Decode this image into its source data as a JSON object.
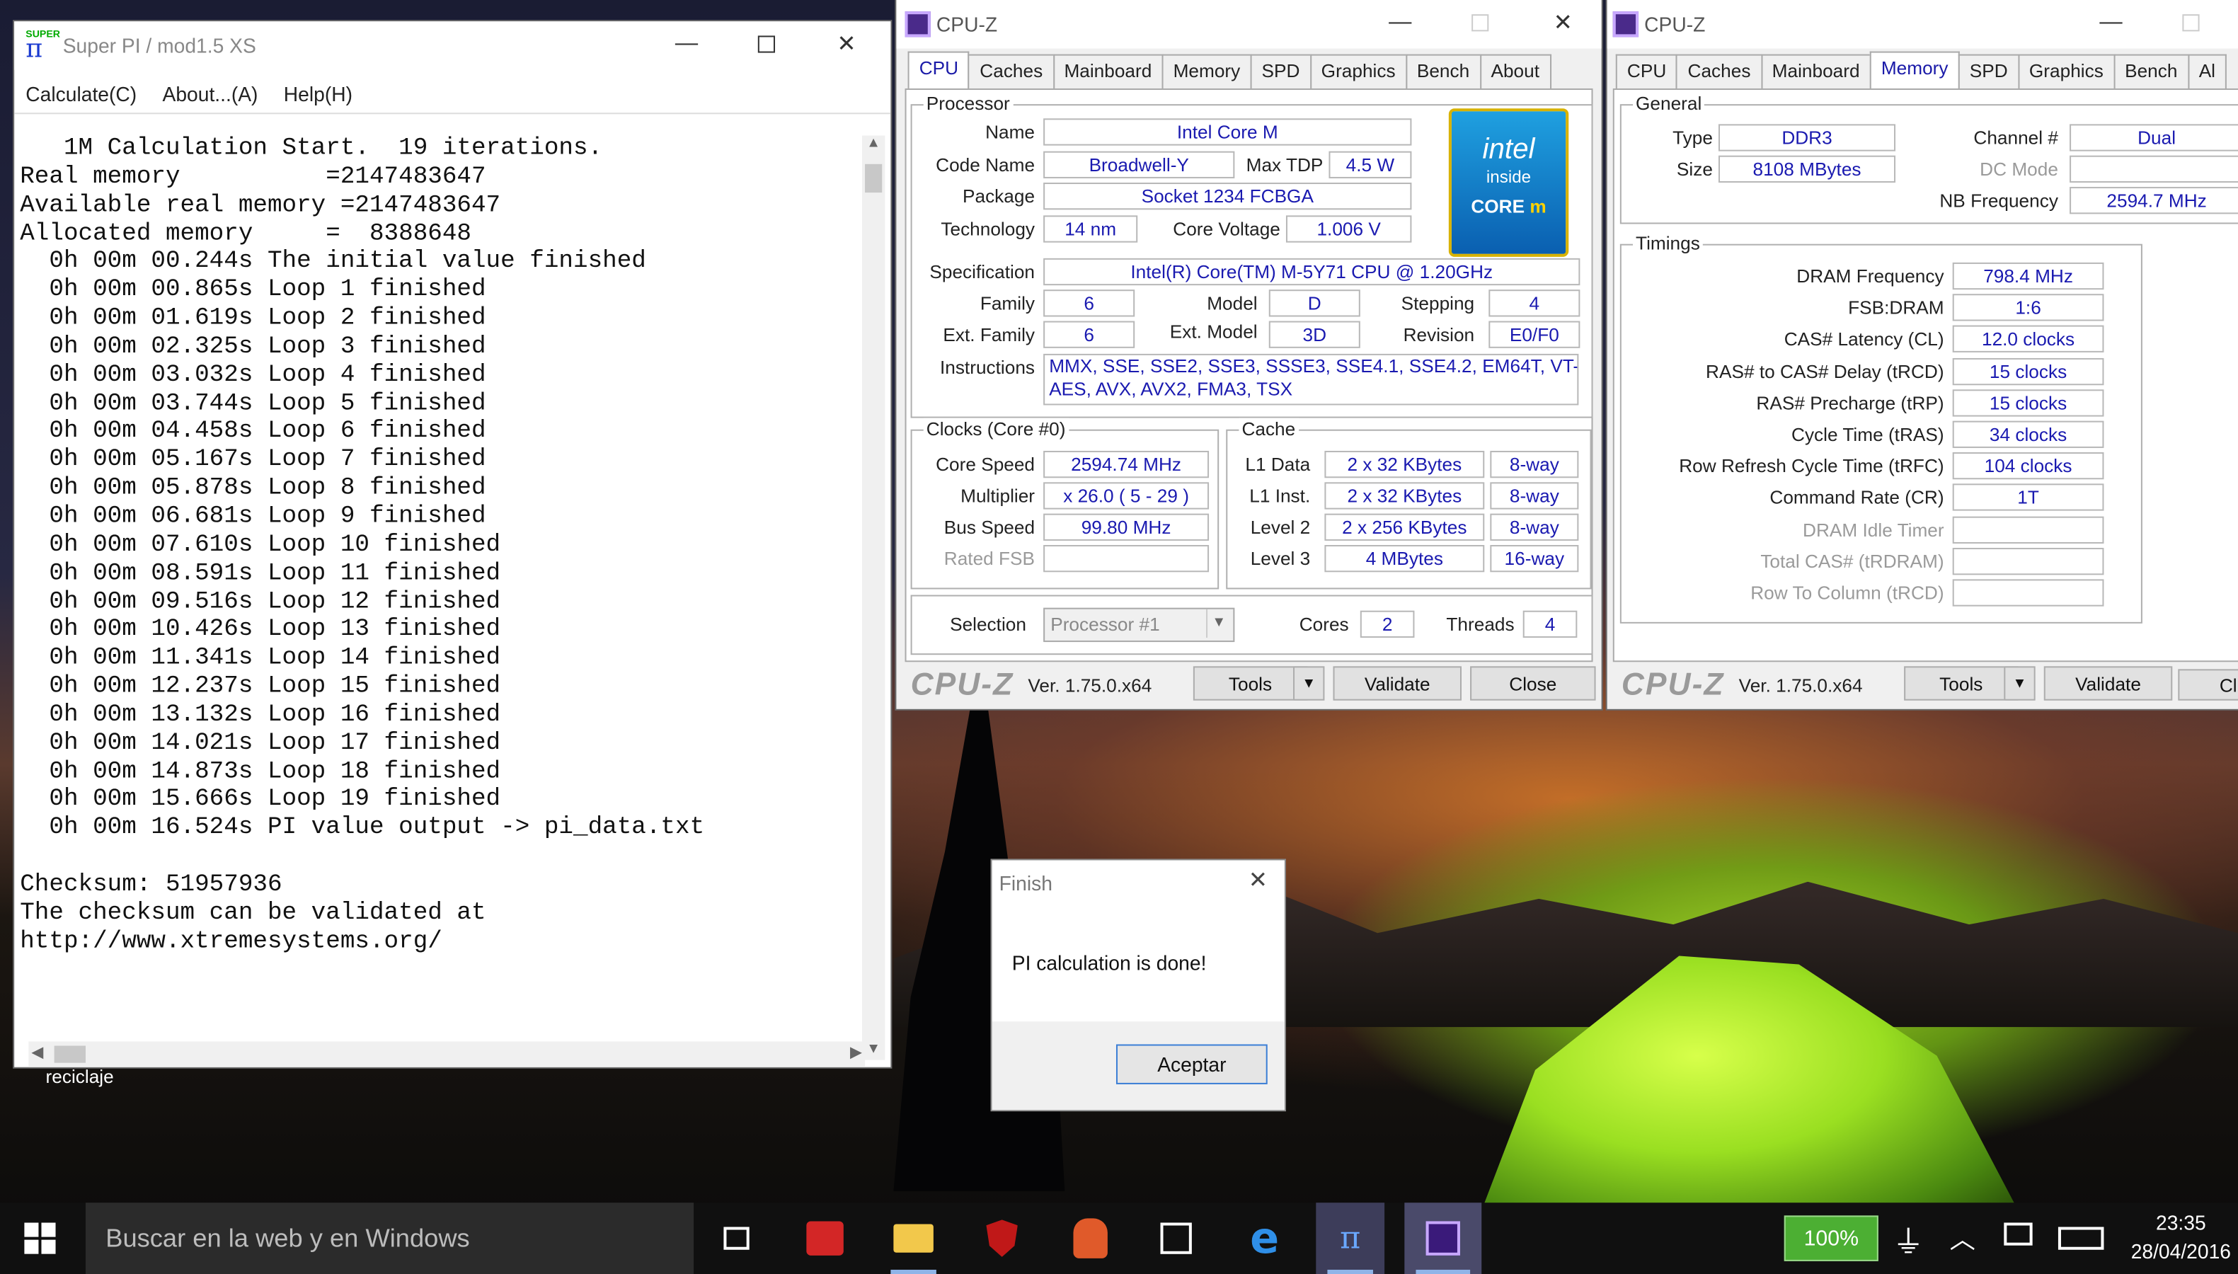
{
  "superpi": {
    "title": "Super PI / mod1.5 XS",
    "icon_text": "SUPER",
    "menu": [
      "Calculate(C)",
      "About...(A)",
      "Help(H)"
    ],
    "console_lines": [
      "   1M Calculation Start.  19 iterations.",
      "Real memory          =2147483647",
      "Available real memory =2147483647",
      "Allocated memory     =  8388648",
      "  0h 00m 00.244s The initial value finished",
      "  0h 00m 00.865s Loop 1 finished",
      "  0h 00m 01.619s Loop 2 finished",
      "  0h 00m 02.325s Loop 3 finished",
      "  0h 00m 03.032s Loop 4 finished",
      "  0h 00m 03.744s Loop 5 finished",
      "  0h 00m 04.458s Loop 6 finished",
      "  0h 00m 05.167s Loop 7 finished",
      "  0h 00m 05.878s Loop 8 finished",
      "  0h 00m 06.681s Loop 9 finished",
      "  0h 00m 07.610s Loop 10 finished",
      "  0h 00m 08.591s Loop 11 finished",
      "  0h 00m 09.516s Loop 12 finished",
      "  0h 00m 10.426s Loop 13 finished",
      "  0h 00m 11.341s Loop 14 finished",
      "  0h 00m 12.237s Loop 15 finished",
      "  0h 00m 13.132s Loop 16 finished",
      "  0h 00m 14.021s Loop 17 finished",
      "  0h 00m 14.873s Loop 18 finished",
      "  0h 00m 15.666s Loop 19 finished",
      "  0h 00m 16.524s PI value output -> pi_data.txt",
      "",
      "Checksum: 51957936",
      "The checksum can be validated at",
      "http://www.xtremesystems.org/"
    ]
  },
  "desktop": {
    "recycle_label": "reciclaje"
  },
  "cpuz_cpu": {
    "title": "CPU-Z",
    "tabs": [
      "CPU",
      "Caches",
      "Mainboard",
      "Memory",
      "SPD",
      "Graphics",
      "Bench",
      "About"
    ],
    "active_tab": "CPU",
    "processor_group": "Processor",
    "labels": {
      "name": "Name",
      "codename": "Code Name",
      "maxtdp": "Max TDP",
      "package": "Package",
      "technology": "Technology",
      "corevoltage": "Core Voltage",
      "specification": "Specification",
      "family": "Family",
      "model": "Model",
      "stepping": "Stepping",
      "extfamily": "Ext. Family",
      "extmodel": "Ext. Model",
      "revision": "Revision",
      "instructions": "Instructions"
    },
    "values": {
      "name": "Intel Core M",
      "codename": "Broadwell-Y",
      "maxtdp": "4.5 W",
      "package": "Socket 1234 FCBGA",
      "technology": "14 nm",
      "corevoltage": "1.006 V",
      "specification": "Intel(R) Core(TM) M-5Y71 CPU @ 1.20GHz",
      "family": "6",
      "model": "D",
      "stepping": "4",
      "extfamily": "6",
      "extmodel": "3D",
      "revision": "E0/F0",
      "instructions_1": "MMX, SSE, SSE2, SSE3, SSSE3, SSE4.1, SSE4.2, EM64T, VT-x,",
      "instructions_2": "AES, AVX, AVX2, FMA3, TSX"
    },
    "intel_logo": {
      "brand": "intel",
      "inside": "inside",
      "core": "CORE",
      "m": "m"
    },
    "clocks_group": "Clocks (Core #0)",
    "clocks_labels": {
      "corespeed": "Core Speed",
      "multiplier": "Multiplier",
      "busspeed": "Bus Speed",
      "ratedfsb": "Rated FSB"
    },
    "clocks_values": {
      "corespeed": "2594.74 MHz",
      "multiplier": "x 26.0 ( 5 - 29 )",
      "busspeed": "99.80 MHz",
      "ratedfsb": ""
    },
    "cache_group": "Cache",
    "cache_rows": [
      {
        "label": "L1 Data",
        "size": "2 x 32 KBytes",
        "way": "8-way"
      },
      {
        "label": "L1 Inst.",
        "size": "2 x 32 KBytes",
        "way": "8-way"
      },
      {
        "label": "Level 2",
        "size": "2 x 256 KBytes",
        "way": "8-way"
      },
      {
        "label": "Level 3",
        "size": "4 MBytes",
        "way": "16-way"
      }
    ],
    "selection_label": "Selection",
    "selection_value": "Processor #1",
    "cores_label": "Cores",
    "cores_value": "2",
    "threads_label": "Threads",
    "threads_value": "4",
    "logo": "CPU-Z",
    "version": "Ver. 1.75.0.x64",
    "tools_btn": "Tools",
    "validate_btn": "Validate",
    "close_btn": "Close"
  },
  "cpuz_mem": {
    "title": "CPU-Z",
    "tabs": [
      "CPU",
      "Caches",
      "Mainboard",
      "Memory",
      "SPD",
      "Graphics",
      "Bench",
      "Al"
    ],
    "active_tab": "Memory",
    "general_group": "General",
    "general": {
      "type_label": "Type",
      "type_value": "DDR3",
      "size_label": "Size",
      "size_value": "8108 MBytes",
      "channel_label": "Channel #",
      "channel_value": "Dual",
      "dcmode_label": "DC Mode",
      "dcmode_value": "",
      "nbfreq_label": "NB Frequency",
      "nbfreq_value": "2594.7 MHz"
    },
    "timings_group": "Timings",
    "timings": [
      {
        "label": "DRAM Frequency",
        "value": "798.4 MHz",
        "dim": false
      },
      {
        "label": "FSB:DRAM",
        "value": "1:6",
        "dim": false
      },
      {
        "label": "CAS# Latency (CL)",
        "value": "12.0 clocks",
        "dim": false
      },
      {
        "label": "RAS# to CAS# Delay (tRCD)",
        "value": "15 clocks",
        "dim": false
      },
      {
        "label": "RAS# Precharge (tRP)",
        "value": "15 clocks",
        "dim": false
      },
      {
        "label": "Cycle Time (tRAS)",
        "value": "34 clocks",
        "dim": false
      },
      {
        "label": "Row Refresh Cycle Time (tRFC)",
        "value": "104 clocks",
        "dim": false
      },
      {
        "label": "Command Rate (CR)",
        "value": "1T",
        "dim": false
      },
      {
        "label": "DRAM Idle Timer",
        "value": "",
        "dim": true
      },
      {
        "label": "Total CAS# (tRDRAM)",
        "value": "",
        "dim": true
      },
      {
        "label": "Row To Column (tRCD)",
        "value": "",
        "dim": true
      }
    ],
    "logo": "CPU-Z",
    "version": "Ver. 1.75.0.x64",
    "tools_btn": "Tools",
    "validate_btn": "Validate",
    "close_btn": "Cl"
  },
  "dialog": {
    "title": "Finish",
    "message": "PI calculation is done!",
    "ok_btn": "Aceptar"
  },
  "taskbar": {
    "search_placeholder": "Buscar en la web y en Windows",
    "battery": "100%",
    "time": "23:35",
    "date": "28/04/2016",
    "colors": {
      "accent": "#8fb4e8",
      "battery_green": "#4caf33"
    }
  }
}
